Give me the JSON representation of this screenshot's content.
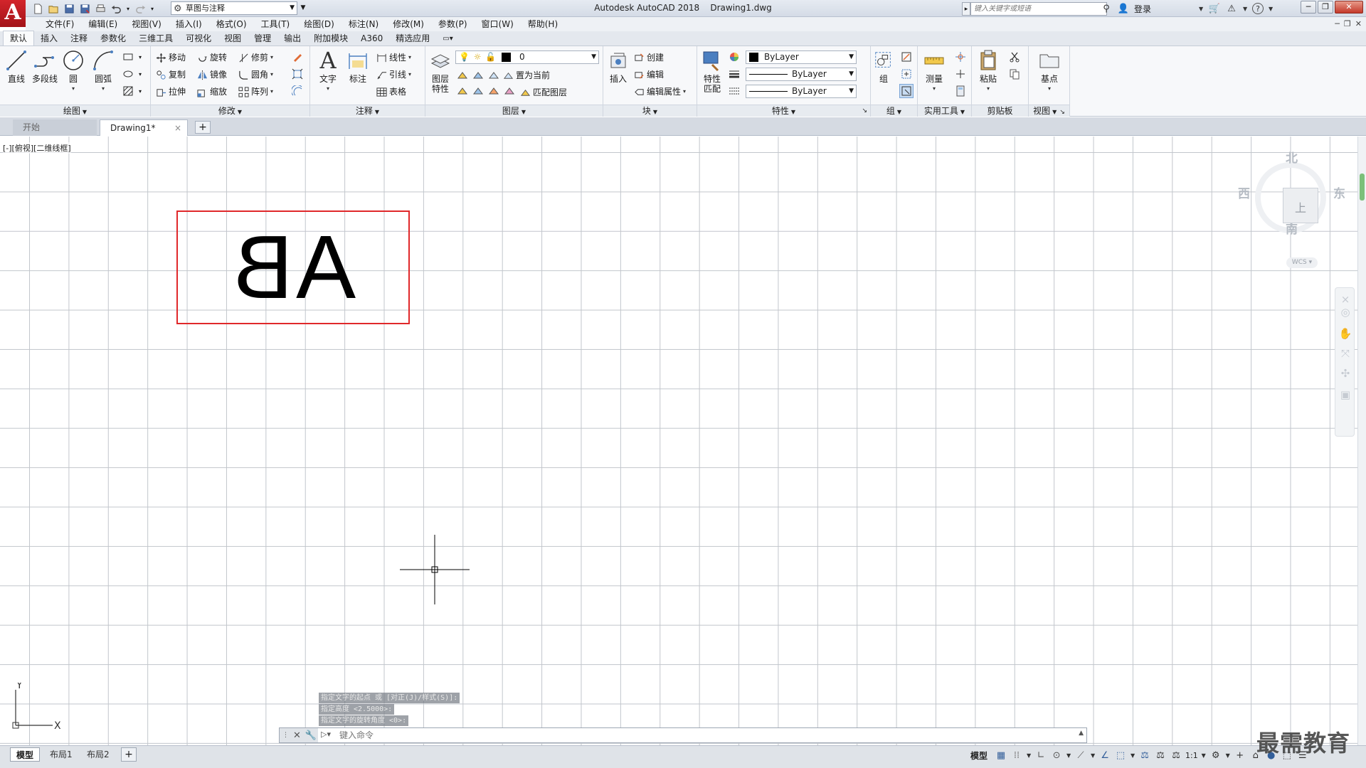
{
  "app": {
    "logo": "A",
    "title": "Autodesk AutoCAD 2018    Drawing1.dwg"
  },
  "quick_access": {
    "workspace": "草图与注释"
  },
  "search": {
    "placeholder": "键入关键字或短语"
  },
  "user": {
    "login": "登录"
  },
  "menu": [
    "文件(F)",
    "编辑(E)",
    "视图(V)",
    "插入(I)",
    "格式(O)",
    "工具(T)",
    "绘图(D)",
    "标注(N)",
    "修改(M)",
    "参数(P)",
    "窗口(W)",
    "帮助(H)"
  ],
  "ribbon_tabs": [
    "默认",
    "插入",
    "注释",
    "参数化",
    "三维工具",
    "可视化",
    "视图",
    "管理",
    "输出",
    "附加模块",
    "A360",
    "精选应用"
  ],
  "ribbon": {
    "draw": {
      "title": "绘图",
      "line": "直线",
      "polyline": "多段线",
      "circle": "圆",
      "arc": "圆弧"
    },
    "modify": {
      "title": "修改",
      "move": "移动",
      "rotate": "旋转",
      "trim": "修剪",
      "copy": "复制",
      "mirror": "镜像",
      "fillet": "圆角",
      "stretch": "拉伸",
      "scale": "缩放",
      "array": "阵列"
    },
    "annotation": {
      "title": "注释",
      "text": "文字",
      "dimension": "标注",
      "linear": "线性",
      "leader": "引线",
      "table": "表格"
    },
    "layers": {
      "title": "图层",
      "properties_line1": "图层",
      "properties_line2": "特性",
      "current_layer": "0",
      "make_current": "置为当前",
      "match_layer": "匹配图层"
    },
    "block": {
      "title": "块",
      "insert": "插入",
      "create": "创建",
      "edit": "编辑",
      "edit_attributes": "编辑属性"
    },
    "properties": {
      "title": "特性",
      "match_line1": "特性",
      "match_line2": "匹配",
      "color": "ByLayer",
      "lineweight": "ByLayer",
      "linetype": "ByLayer"
    },
    "groups": {
      "title": "组",
      "group": "组"
    },
    "utilities": {
      "title": "实用工具",
      "measure": "测量"
    },
    "clipboard": {
      "title": "剪贴板",
      "paste": "粘贴"
    },
    "view": {
      "title": "视图",
      "base": "基点"
    }
  },
  "file_tabs": {
    "start": "开始",
    "drawing": "Drawing1*",
    "close": "×",
    "new": "+"
  },
  "viewport": {
    "label": "[-][俯视][二维线框]",
    "mirrored_text": "AB",
    "frame_color": "#e0282a"
  },
  "viewcube": {
    "north": "北",
    "east": "东",
    "south": "南",
    "west": "西",
    "face": "上",
    "wcs": "WCS"
  },
  "ucs": {
    "x": "X",
    "y": "Y"
  },
  "command": {
    "history": [
      "指定文字的起点 或 [对正(J)/样式(S)]:",
      "指定高度 <2.5000>:",
      "指定文字的旋转角度 <0>:"
    ],
    "placeholder": "键入命令"
  },
  "layout_tabs": {
    "model": "模型",
    "layout1": "布局1",
    "layout2": "布局2",
    "add": "+"
  },
  "status": {
    "model": "模型",
    "scale": "1:1"
  },
  "watermark": "最需教育"
}
